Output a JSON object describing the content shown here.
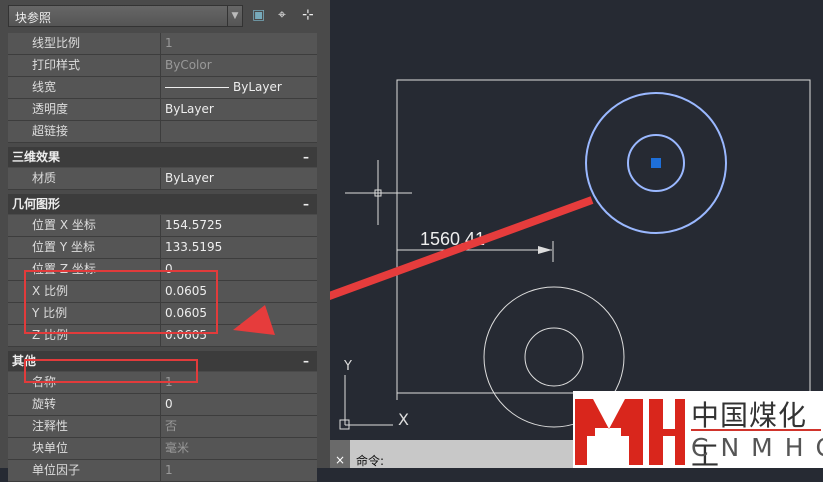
{
  "panel": {
    "dropdown": "块参照",
    "rows_general": [
      {
        "k": "线型比例",
        "v": "1",
        "dim": true
      },
      {
        "k": "打印样式",
        "v": "ByColor",
        "dim": true
      },
      {
        "k": "线宽",
        "v": "ByLayer"
      },
      {
        "k": "透明度",
        "v": "ByLayer"
      },
      {
        "k": "超链接",
        "v": ""
      }
    ],
    "sec3d": "三维效果",
    "rows3d": [
      {
        "k": "材质",
        "v": "ByLayer"
      }
    ],
    "secgeo": "几何图形",
    "rowsgeo": [
      {
        "k": "位置 X 坐标",
        "v": "154.5725"
      },
      {
        "k": "位置 Y 坐标",
        "v": "133.5195"
      },
      {
        "k": "位置 Z 坐标",
        "v": "0"
      },
      {
        "k": "X 比例",
        "v": "0.0605"
      },
      {
        "k": "Y 比例",
        "v": "0.0605"
      },
      {
        "k": "Z 比例",
        "v": "0.0605"
      }
    ],
    "secother": "其他",
    "rowsother": [
      {
        "k": "名称",
        "v": "1",
        "dim": true
      },
      {
        "k": "旋转",
        "v": "0"
      },
      {
        "k": "注释性",
        "v": "否",
        "dim": true
      },
      {
        "k": "块单位",
        "v": "毫米",
        "dim": true
      },
      {
        "k": "单位因子",
        "v": "1",
        "dim": true
      }
    ],
    "collapse": "–"
  },
  "canvas": {
    "dimension": "1560.41",
    "ucs_y": "Y",
    "ucs_x": "X"
  },
  "command": {
    "label": "命令:",
    "close": "×"
  },
  "logo": {
    "mark": "MH",
    "cn": "中国煤化工",
    "en": "CNMHG"
  }
}
